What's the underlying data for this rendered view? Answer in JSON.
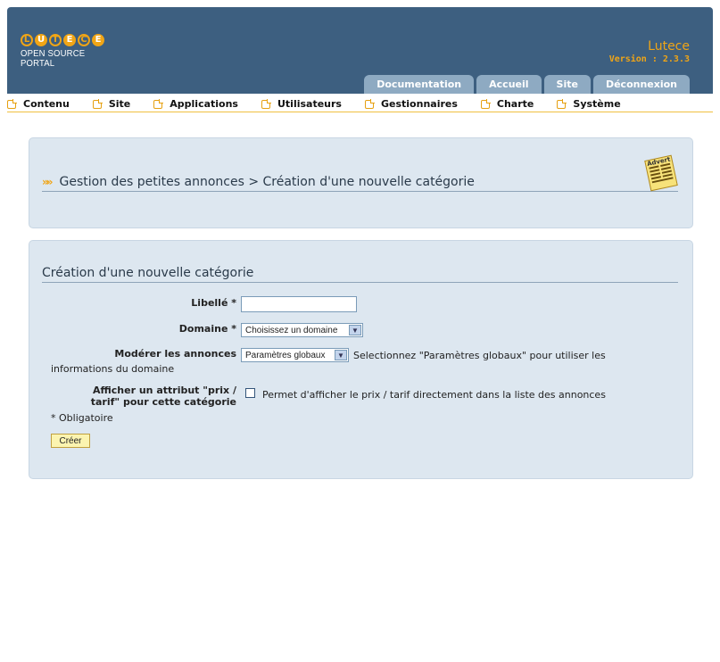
{
  "header": {
    "logo_letters": [
      "L",
      "U",
      "T",
      "E",
      "C",
      "E"
    ],
    "logo_subtitle": "OPEN SOURCE PORTAL",
    "brand_name": "Lutece",
    "version": "Version : 2.3.3",
    "tabs": [
      "Documentation",
      "Accueil",
      "Site",
      "Déconnexion"
    ]
  },
  "menu": {
    "items": [
      "Contenu",
      "Site",
      "Applications",
      "Utilisateurs",
      "Gestionnaires",
      "Charte",
      "Système"
    ]
  },
  "breadcrumb": {
    "text": "Gestion des petites annonces  > Création d'une nouvelle catégorie",
    "advert_icon_label": "Advert"
  },
  "form": {
    "title": "Création d'une nouvelle catégorie",
    "label_libelle": "Libellé *",
    "libelle_value": "",
    "label_domaine": "Domaine *",
    "domaine_selected": "Choisissez un domaine",
    "label_moderer": "Modérer les annonces",
    "moderer_selected": "Paramètres globaux",
    "moderer_help_1": "Selectionnez \"Paramètres globaux\" pour utiliser les",
    "moderer_help_2": "informations du domaine",
    "label_afficher_1": "Afficher un attribut \"prix /",
    "label_afficher_2": "tarif\" pour cette catégorie",
    "afficher_help": "Permet d'afficher le prix / tarif directement dans la liste des annonces",
    "required_note": "* Obligatoire",
    "submit_label": "Créer"
  },
  "colors": {
    "header_bg": "#3d5f80",
    "tab_bg": "#8eaac2",
    "accent": "#f0a516",
    "panel_bg": "#dde7f0"
  }
}
